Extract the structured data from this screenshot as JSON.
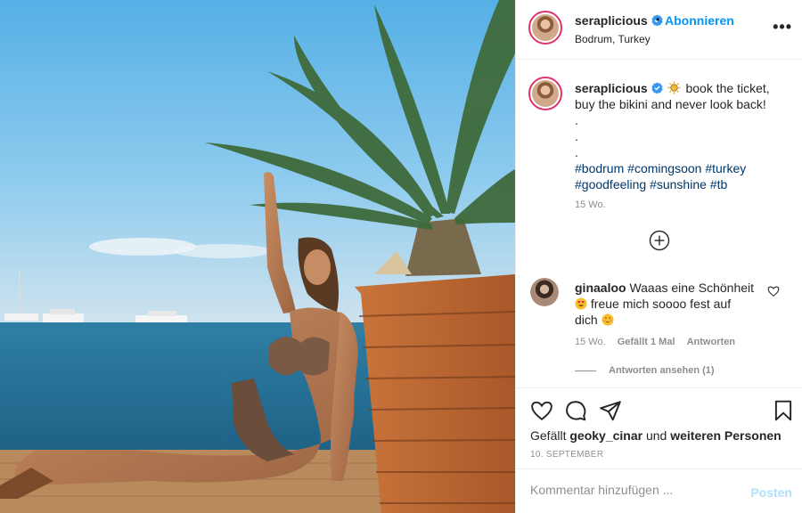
{
  "post": {
    "username": "seraplicious",
    "follow_label": "Abonnieren",
    "separator": "•",
    "location": "Bodrum, Turkey",
    "more_label": "•••",
    "caption": {
      "line1": "book the ticket,",
      "line2": "buy the bikini and never look back!",
      "dot": ".",
      "hashtags": [
        "#bodrum",
        "#comingsoon",
        "#turkey",
        "#goodfeeling",
        "#sunshine",
        "#tb"
      ],
      "time": "15 Wo."
    },
    "comment": {
      "username": "ginaaloo",
      "text1": "Waaas eine Schönheit",
      "text2": "freue mich soooo fest auf",
      "text3": "dich",
      "time": "15 Wo.",
      "likes": "Gefällt 1 Mal",
      "reply": "Antworten",
      "view_replies": "Antworten ansehen (1)"
    },
    "likes": {
      "prefix": "Gefällt",
      "user": "geoky_cinar",
      "middle": "und",
      "others": "weiteren Personen"
    },
    "date": "10. SEPTEMBER",
    "add_comment": {
      "placeholder": "Kommentar hinzufügen ...",
      "post_label": "Posten"
    }
  },
  "colors": {
    "link_blue": "#0095f6",
    "post_disabled": "#b2dffc",
    "hashtag": "#00376b",
    "muted": "#8e8e8e",
    "verified_badge": "#3897f0"
  },
  "icons": [
    "verified-badge-icon",
    "sun-emoji-icon",
    "more-options-icon",
    "plus-circle-icon",
    "heart-eyes-emoji-icon",
    "smiling-emoji-icon",
    "heart-icon",
    "comment-icon",
    "share-icon",
    "bookmark-icon"
  ]
}
